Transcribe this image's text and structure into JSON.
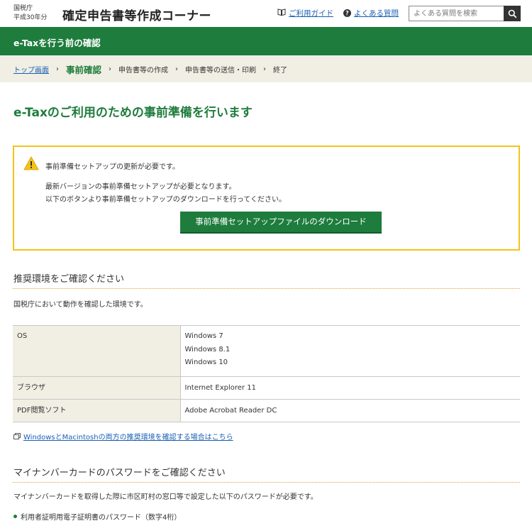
{
  "header": {
    "agency": "国税庁",
    "year": "平成30年分",
    "title": "確定申告書等作成コーナー",
    "guide_link": "ご利用ガイド",
    "faq_link": "よくある質問",
    "search_placeholder": "よくある質問を検索",
    "icons": [
      "book-icon",
      "question-icon",
      "search-icon"
    ]
  },
  "greenbar": {
    "title": "e-Taxを行う前の確認"
  },
  "breadcrumb": {
    "items": [
      "トップ画面",
      "事前確認",
      "申告書等の作成",
      "申告書等の送信・印刷",
      "終了"
    ]
  },
  "main": {
    "title": "e-Taxのご利用のための事前準備を行います",
    "warning": {
      "heading": "事前準備セットアップの更新が必要です。",
      "line1": "最新バージョンの事前準備セットアップが必要となります。",
      "line2": "以下のボタンより事前準備セットアップのダウンロードを行ってください。",
      "button": "事前準備セットアップファイルのダウンロード"
    },
    "env_section": {
      "title": "推奨環境をご確認ください",
      "desc": "国税庁において動作を確認した環境です。",
      "rows": [
        {
          "label": "OS",
          "values": [
            "Windows 7",
            "Windows 8.1",
            "Windows 10"
          ]
        },
        {
          "label": "ブラウザ",
          "values": [
            "Internet Explorer 11"
          ]
        },
        {
          "label": "PDF閲覧ソフト",
          "values": [
            "Adobe Acrobat Reader DC"
          ]
        }
      ],
      "link": "WindowsとMacintoshの両方の推奨環境を確認する場合はこちら"
    },
    "mynumber_section": {
      "title": "マイナンバーカードのパスワードをご確認ください",
      "desc": "マイナンバーカードを取得した際に市区町村の窓口等で設定した以下のパスワードが必要です。",
      "bullet": "利用者証明用電子証明書のパスワード（数字4桁）"
    }
  },
  "colors": {
    "brand_green": "#1e7c3c",
    "warning_yellow": "#f3c318",
    "crumb_bg": "#f1efe4",
    "link_blue": "#1a5fb4"
  }
}
